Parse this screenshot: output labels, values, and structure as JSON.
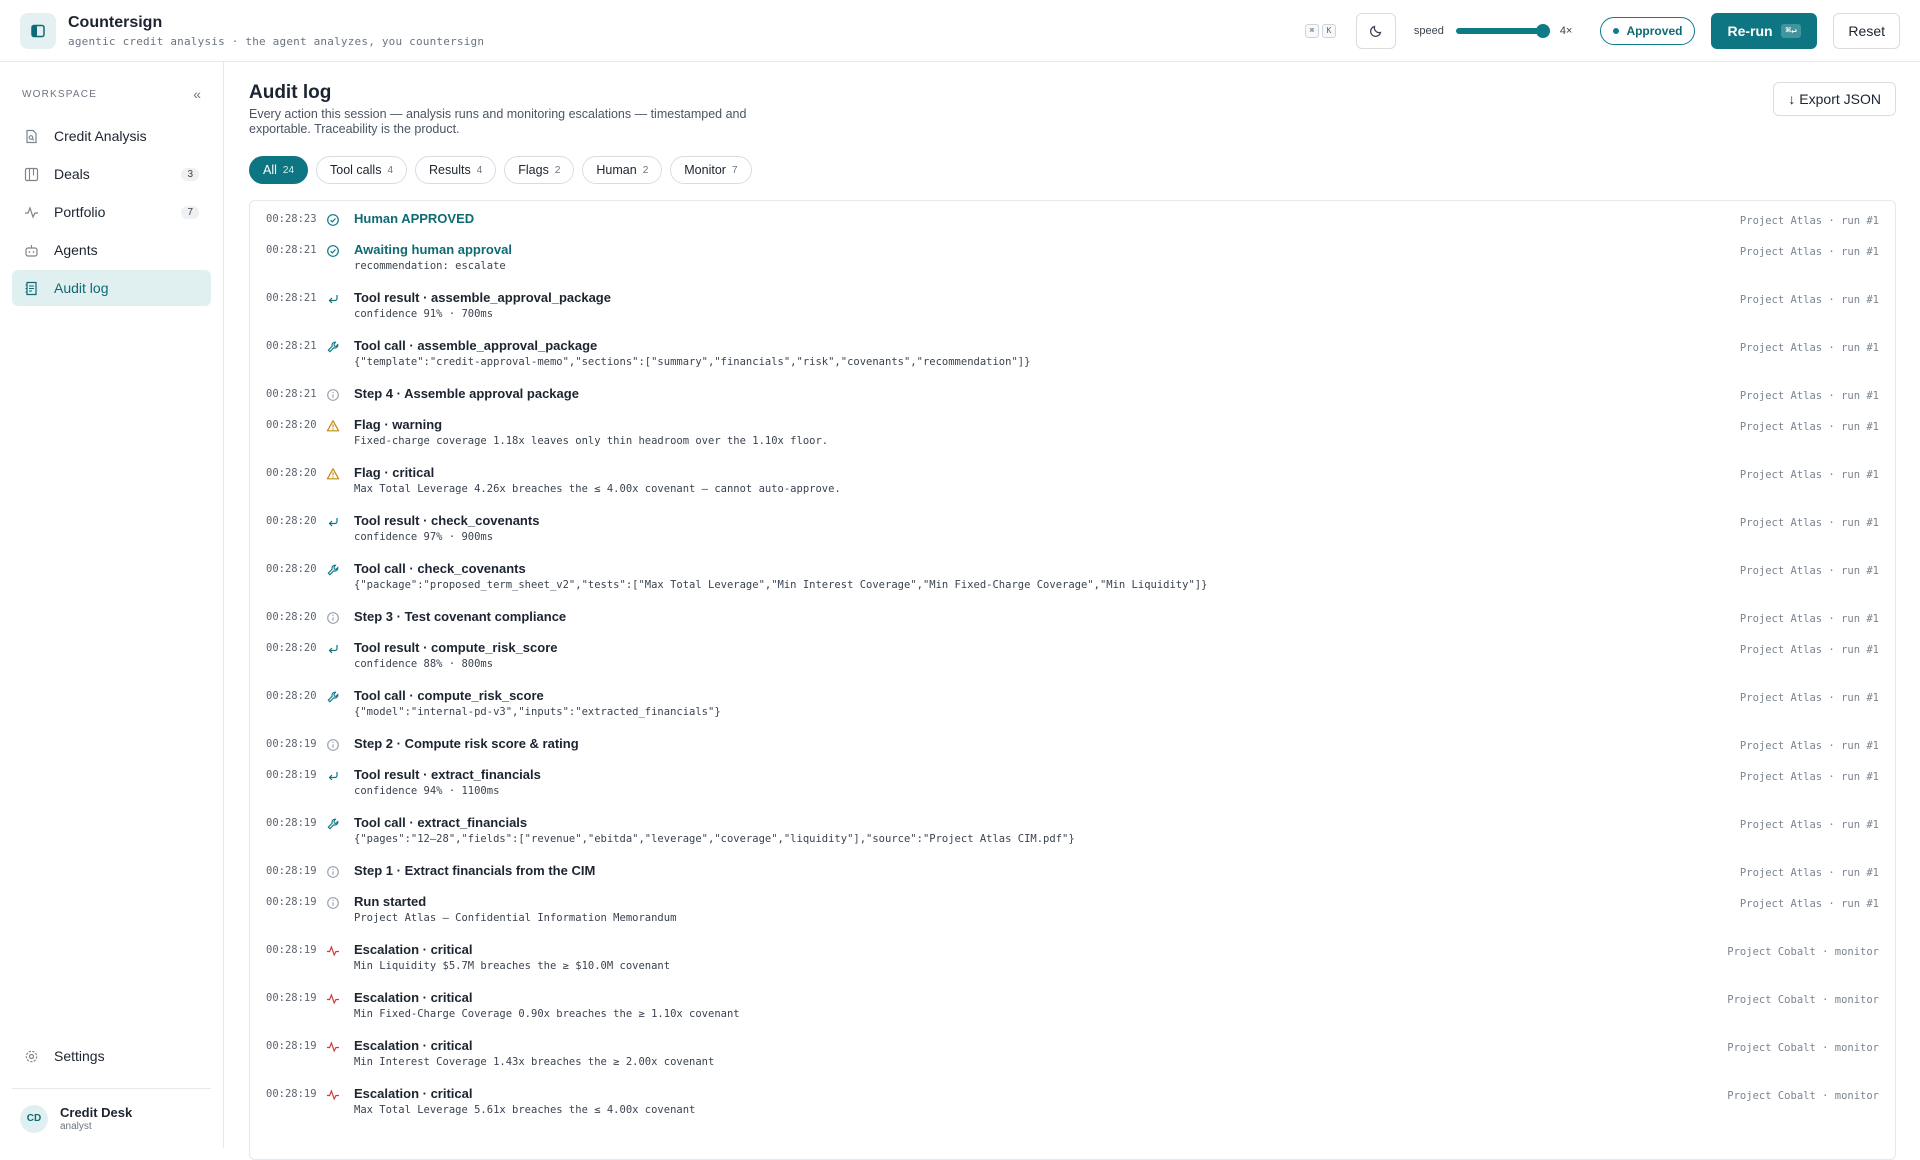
{
  "header": {
    "app_title": "Countersign",
    "app_subtitle": "agentic credit analysis · the agent analyzes, you countersign",
    "kbd_cmd": "⌘",
    "kbd_k": "K",
    "speed_label": "speed",
    "speed_value": "4×",
    "speed_fraction": 1.0,
    "status": "Approved",
    "rerun_label": "Re-run",
    "rerun_kbd": "⌘↵",
    "reset_label": "Reset"
  },
  "sidebar": {
    "section_label": "WORKSPACE",
    "items": [
      {
        "label": "Credit Analysis",
        "icon": "document-search-icon",
        "badge": ""
      },
      {
        "label": "Deals",
        "icon": "deals-board-icon",
        "badge": "3"
      },
      {
        "label": "Portfolio",
        "icon": "activity-icon",
        "badge": "7"
      },
      {
        "label": "Agents",
        "icon": "bot-icon",
        "badge": ""
      },
      {
        "label": "Audit log",
        "icon": "audit-log-icon",
        "badge": ""
      }
    ],
    "settings_label": "Settings",
    "user": {
      "initials": "CD",
      "name": "Credit Desk",
      "role": "analyst"
    }
  },
  "main": {
    "title": "Audit log",
    "description": "Every action this session — analysis runs and monitoring escalations — timestamped and exportable. Traceability is the product.",
    "export_label": "↓ Export JSON",
    "filters": [
      {
        "label": "All",
        "count": "24"
      },
      {
        "label": "Tool calls",
        "count": "4"
      },
      {
        "label": "Results",
        "count": "4"
      },
      {
        "label": "Flags",
        "count": "2"
      },
      {
        "label": "Human",
        "count": "2"
      },
      {
        "label": "Monitor",
        "count": "7"
      }
    ],
    "entries": [
      {
        "time": "00:28:23",
        "kind": "approval",
        "title": "Human APPROVED",
        "detail": "",
        "source": "Project Atlas · run #1"
      },
      {
        "time": "00:28:21",
        "kind": "approval",
        "title": "Awaiting human approval",
        "detail": "recommendation: escalate",
        "source": "Project Atlas · run #1"
      },
      {
        "time": "00:28:21",
        "kind": "result",
        "title": "Tool result · assemble_approval_package",
        "detail": "confidence 91% · 700ms",
        "source": "Project Atlas · run #1"
      },
      {
        "time": "00:28:21",
        "kind": "call",
        "title": "Tool call · assemble_approval_package",
        "detail": "{\"template\":\"credit-approval-memo\",\"sections\":[\"summary\",\"financials\",\"risk\",\"covenants\",\"recommendation\"]}",
        "source": "Project Atlas · run #1"
      },
      {
        "time": "00:28:21",
        "kind": "step",
        "title": "Step 4 · Assemble approval package",
        "detail": "",
        "source": "Project Atlas · run #1"
      },
      {
        "time": "00:28:20",
        "kind": "flag",
        "title": "Flag · warning",
        "detail": "Fixed-charge coverage 1.18x leaves only thin headroom over the 1.10x floor.",
        "source": "Project Atlas · run #1"
      },
      {
        "time": "00:28:20",
        "kind": "flag",
        "title": "Flag · critical",
        "detail": "Max Total Leverage 4.26x breaches the ≤ 4.00x covenant — cannot auto-approve.",
        "source": "Project Atlas · run #1"
      },
      {
        "time": "00:28:20",
        "kind": "result",
        "title": "Tool result · check_covenants",
        "detail": "confidence 97% · 900ms",
        "source": "Project Atlas · run #1"
      },
      {
        "time": "00:28:20",
        "kind": "call",
        "title": "Tool call · check_covenants",
        "detail": "{\"package\":\"proposed_term_sheet_v2\",\"tests\":[\"Max Total Leverage\",\"Min Interest Coverage\",\"Min Fixed-Charge Coverage\",\"Min Liquidity\"]}",
        "source": "Project Atlas · run #1"
      },
      {
        "time": "00:28:20",
        "kind": "step",
        "title": "Step 3 · Test covenant compliance",
        "detail": "",
        "source": "Project Atlas · run #1"
      },
      {
        "time": "00:28:20",
        "kind": "result",
        "title": "Tool result · compute_risk_score",
        "detail": "confidence 88% · 800ms",
        "source": "Project Atlas · run #1"
      },
      {
        "time": "00:28:20",
        "kind": "call",
        "title": "Tool call · compute_risk_score",
        "detail": "{\"model\":\"internal-pd-v3\",\"inputs\":\"extracted_financials\"}",
        "source": "Project Atlas · run #1"
      },
      {
        "time": "00:28:19",
        "kind": "step",
        "title": "Step 2 · Compute risk score & rating",
        "detail": "",
        "source": "Project Atlas · run #1"
      },
      {
        "time": "00:28:19",
        "kind": "result",
        "title": "Tool result · extract_financials",
        "detail": "confidence 94% · 1100ms",
        "source": "Project Atlas · run #1"
      },
      {
        "time": "00:28:19",
        "kind": "call",
        "title": "Tool call · extract_financials",
        "detail": "{\"pages\":\"12–28\",\"fields\":[\"revenue\",\"ebitda\",\"leverage\",\"coverage\",\"liquidity\"],\"source\":\"Project Atlas CIM.pdf\"}",
        "source": "Project Atlas · run #1"
      },
      {
        "time": "00:28:19",
        "kind": "step",
        "title": "Step 1 · Extract financials from the CIM",
        "detail": "",
        "source": "Project Atlas · run #1"
      },
      {
        "time": "00:28:19",
        "kind": "step",
        "title": "Run started",
        "detail": "Project Atlas — Confidential Information Memorandum",
        "source": "Project Atlas · run #1"
      },
      {
        "time": "00:28:19",
        "kind": "escalation",
        "title": "Escalation · critical",
        "detail": "Min Liquidity $5.7M breaches the ≥ $10.0M covenant",
        "source": "Project Cobalt · monitor"
      },
      {
        "time": "00:28:19",
        "kind": "escalation",
        "title": "Escalation · critical",
        "detail": "Min Fixed-Charge Coverage 0.90x breaches the ≥ 1.10x covenant",
        "source": "Project Cobalt · monitor"
      },
      {
        "time": "00:28:19",
        "kind": "escalation",
        "title": "Escalation · critical",
        "detail": "Min Interest Coverage 1.43x breaches the ≥ 2.00x covenant",
        "source": "Project Cobalt · monitor"
      },
      {
        "time": "00:28:19",
        "kind": "escalation",
        "title": "Escalation · critical",
        "detail": "Max Total Leverage 5.61x breaches the ≤ 4.00x covenant",
        "source": "Project Cobalt · monitor"
      }
    ]
  },
  "colors": {
    "accent": "#0e7682",
    "accent_soft": "#e0eff0",
    "warning": "#c08a12",
    "critical": "#d63b3b"
  }
}
